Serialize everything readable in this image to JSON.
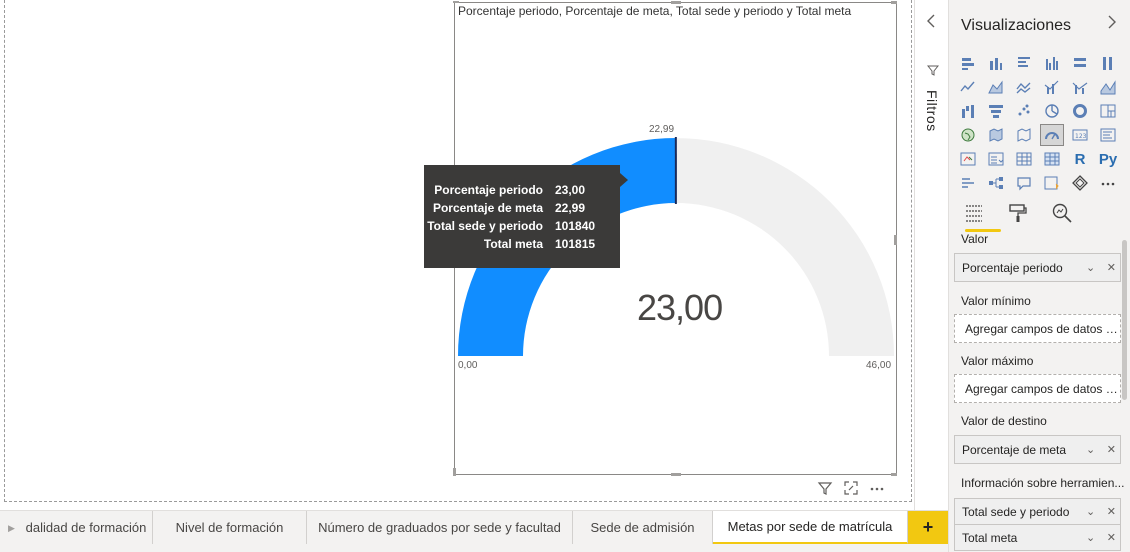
{
  "visual": {
    "title": "Porcentaje periodo, Porcentaje de meta, Total sede y periodo y Total meta",
    "gauge": {
      "value": 23.0,
      "min": 0,
      "max": 46,
      "target": 22.99,
      "value_label": "23,00",
      "min_label": "0,00",
      "max_label": "46,00",
      "target_label": "22,99",
      "fill_color": "#118dff",
      "track_color": "#f0f0f0",
      "target_color": "#1a2a5a"
    },
    "footer_icons": [
      "filter-icon",
      "focus-mode-icon",
      "more-options-icon"
    ]
  },
  "tooltip": {
    "rows": [
      {
        "name": "Porcentaje periodo",
        "value": "23,00"
      },
      {
        "name": "Porcentaje de meta",
        "value": "22,99"
      },
      {
        "name": "Total sede y periodo",
        "value": "101840"
      },
      {
        "name": "Total meta",
        "value": "101815"
      }
    ]
  },
  "filters_pane": {
    "label": "Filtros"
  },
  "viz_pane": {
    "title": "Visualizaciones",
    "selected_visual": "gauge",
    "wells": {
      "valor_label": "Valor",
      "valor_field": "Porcentaje periodo",
      "minimo_label": "Valor mínimo",
      "minimo_placeholder": "Agregar campos de datos a...",
      "maximo_label": "Valor máximo",
      "maximo_placeholder": "Agregar campos de datos a...",
      "destino_label": "Valor de destino",
      "destino_field": "Porcentaje de meta",
      "tooltips_label": "Información sobre herramien...",
      "tooltips_fields": [
        "Total sede y periodo",
        "Total meta"
      ]
    }
  },
  "page_tabs": [
    {
      "label": "dalidad de formación",
      "active": false
    },
    {
      "label": "Nivel de formación",
      "active": false
    },
    {
      "label": "Número de graduados por sede y facultad",
      "active": false
    },
    {
      "label": "Sede de admisión",
      "active": false
    },
    {
      "label": "Metas por sede de matrícula",
      "active": true
    }
  ],
  "add_page_label": "+"
}
